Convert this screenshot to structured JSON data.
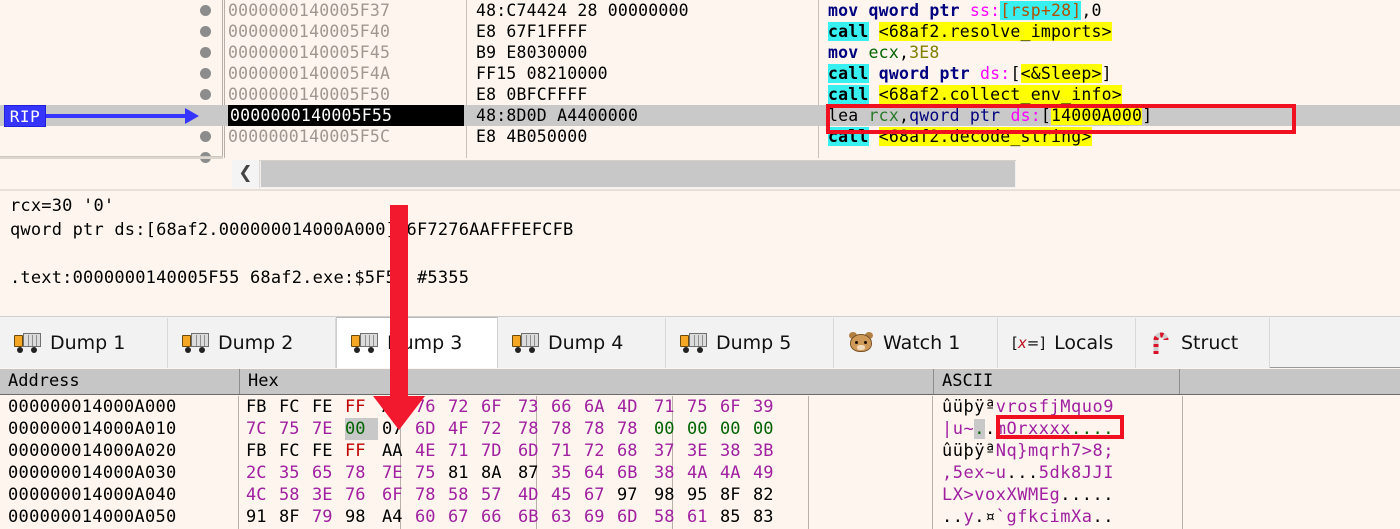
{
  "disassembly": {
    "rows": [
      {
        "address": "0000000140005F37",
        "bytes": "48:C74424 28 00000000",
        "selected": false,
        "tokens": [
          {
            "t": "mov",
            "c": "mn"
          },
          {
            "t": " qword ptr ",
            "c": "mn"
          },
          {
            "t": "ss:",
            "c": "seg"
          },
          {
            "t": "[",
            "c": "brk"
          },
          {
            "t": "rsp+",
            "c": "regred"
          },
          {
            "t": "28",
            "c": "numbr"
          },
          {
            "t": "]",
            "c": "brk"
          },
          {
            "t": ",0",
            "c": "dark"
          }
        ]
      },
      {
        "address": "0000000140005F40",
        "bytes": "E8 67F1FFFF",
        "selected": false,
        "tokens": [
          {
            "t": "call",
            "c": "call"
          },
          {
            "t": " ",
            "c": "dark"
          },
          {
            "t": "<68af2.resolve_imports>",
            "c": "sym"
          }
        ]
      },
      {
        "address": "0000000140005F45",
        "bytes": "B9 E8030000",
        "selected": false,
        "tokens": [
          {
            "t": "mov",
            "c": "mn"
          },
          {
            "t": " ",
            "c": "dark"
          },
          {
            "t": "ecx",
            "c": "reg"
          },
          {
            "t": ",",
            "c": "dark"
          },
          {
            "t": "3E8",
            "c": "num"
          }
        ]
      },
      {
        "address": "0000000140005F4A",
        "bytes": "FF15 08210000",
        "selected": false,
        "tokens": [
          {
            "t": "call",
            "c": "call"
          },
          {
            "t": " ",
            "c": "dark"
          },
          {
            "t": "qword ptr ",
            "c": "mn"
          },
          {
            "t": "ds:",
            "c": "seg"
          },
          {
            "t": "[",
            "c": "dark"
          },
          {
            "t": "<&Sleep>",
            "c": "sym"
          },
          {
            "t": "]",
            "c": "dark"
          }
        ]
      },
      {
        "address": "0000000140005F50",
        "bytes": "E8 0BFCFFFF",
        "selected": false,
        "tokens": [
          {
            "t": "call",
            "c": "call"
          },
          {
            "t": " ",
            "c": "dark"
          },
          {
            "t": "<68af2.collect_env_info>",
            "c": "sym"
          }
        ]
      },
      {
        "address": "0000000140005F55",
        "bytes": "48:8D0D A4400000",
        "selected": true,
        "tokens": [
          {
            "t": "lea",
            "c": "lea"
          },
          {
            "t": " ",
            "c": "dark"
          },
          {
            "t": "rcx",
            "c": "leareg"
          },
          {
            "t": ",",
            "c": "dark"
          },
          {
            "t": "qword ptr ",
            "c": "mem"
          },
          {
            "t": "ds:",
            "c": "seg"
          },
          {
            "t": "[",
            "c": "dark"
          },
          {
            "t": "14000A000",
            "c": "sym"
          },
          {
            "t": "]",
            "c": "dark"
          }
        ]
      },
      {
        "address": "0000000140005F5C",
        "bytes": "E8 4B050000",
        "selected": false,
        "tokens": [
          {
            "t": "call",
            "c": "call"
          },
          {
            "t": " ",
            "c": "dark"
          },
          {
            "t": "<68af2.decode_string>",
            "c": "sym"
          }
        ]
      }
    ],
    "rip_label": "RIP",
    "scroll_left_glyph": "❮"
  },
  "info_panel": {
    "lines": [
      "rcx=30 '0'",
      "qword ptr ds:[68af2.000000014000A000]=6F7276AAFFFEFCFB",
      "",
      ".text:0000000140005F55 68af2.exe:$5F55 #5355"
    ]
  },
  "tabs": [
    {
      "label": "Dump 1",
      "icon": "dump-truck-icon",
      "active": false
    },
    {
      "label": "Dump 2",
      "icon": "dump-truck-icon",
      "active": false
    },
    {
      "label": "Dump 3",
      "icon": "dump-truck-icon",
      "active": true
    },
    {
      "label": "Dump 4",
      "icon": "dump-truck-icon",
      "active": false
    },
    {
      "label": "Dump 5",
      "icon": "dump-truck-icon",
      "active": false
    },
    {
      "label": "Watch 1",
      "icon": "hamster-icon",
      "active": false
    },
    {
      "label": "Locals",
      "icon": "variable-icon",
      "active": false
    },
    {
      "label": "Struct",
      "icon": "candy-cane-icon",
      "active": false
    }
  ],
  "dump": {
    "columns": [
      "Address",
      "Hex",
      "ASCII"
    ],
    "rows": [
      {
        "address": "000000014000A000",
        "bytes": [
          "FB",
          "FC",
          "FE",
          "FF",
          "AA",
          "76",
          "72",
          "6F",
          "73",
          "66",
          "6A",
          "4D",
          "71",
          "75",
          "6F",
          "39"
        ],
        "kinds": [
          "hi",
          "hi",
          "hi",
          "ff",
          "hi",
          "pr",
          "pr",
          "pr",
          "pr",
          "pr",
          "pr",
          "pr",
          "pr",
          "pr",
          "pr",
          "pr"
        ],
        "ascii": "ûüþÿªvrosfjMquo9",
        "ascii_kinds": [
          "hi",
          "hi",
          "hi",
          "hi",
          "hi",
          "pr",
          "pr",
          "pr",
          "pr",
          "pr",
          "pr",
          "pr",
          "pr",
          "pr",
          "pr",
          "pr"
        ]
      },
      {
        "address": "000000014000A010",
        "bytes": [
          "7C",
          "75",
          "7E",
          "00",
          "07",
          "6D",
          "4F",
          "72",
          "78",
          "78",
          "78",
          "78",
          "00",
          "00",
          "00",
          "00"
        ],
        "kinds": [
          "pr",
          "pr",
          "pr",
          "zero-sel",
          "hi",
          "pr",
          "pr",
          "pr",
          "pr",
          "pr",
          "pr",
          "pr",
          "zero",
          "zero",
          "zero",
          "zero"
        ],
        "ascii": "|u~..mOrxxxx....",
        "ascii_kinds": [
          "pr",
          "pr",
          "pr",
          "zero-sel",
          "hi",
          "pr",
          "pr",
          "pr",
          "pr",
          "pr",
          "pr",
          "pr",
          "zero",
          "zero",
          "zero",
          "zero"
        ]
      },
      {
        "address": "000000014000A020",
        "bytes": [
          "FB",
          "FC",
          "FE",
          "FF",
          "AA",
          "4E",
          "71",
          "7D",
          "6D",
          "71",
          "72",
          "68",
          "37",
          "3E",
          "38",
          "3B"
        ],
        "kinds": [
          "hi",
          "hi",
          "hi",
          "ff",
          "hi",
          "pr",
          "pr",
          "pr",
          "pr",
          "pr",
          "pr",
          "pr",
          "pr",
          "pr",
          "pr",
          "pr"
        ],
        "ascii": "ûüþÿªNq}mqrh7>8;",
        "ascii_kinds": [
          "hi",
          "hi",
          "hi",
          "hi",
          "hi",
          "pr",
          "pr",
          "pr",
          "pr",
          "pr",
          "pr",
          "pr",
          "pr",
          "pr",
          "pr",
          "pr"
        ]
      },
      {
        "address": "000000014000A030",
        "bytes": [
          "2C",
          "35",
          "65",
          "78",
          "7E",
          "75",
          "81",
          "8A",
          "87",
          "35",
          "64",
          "6B",
          "38",
          "4A",
          "4A",
          "49"
        ],
        "kinds": [
          "pr",
          "pr",
          "pr",
          "pr",
          "pr",
          "pr",
          "hi",
          "hi",
          "hi",
          "pr",
          "pr",
          "pr",
          "pr",
          "pr",
          "pr",
          "pr"
        ],
        "ascii": ",5ex~u...5dk8JJI",
        "ascii_kinds": [
          "pr",
          "pr",
          "pr",
          "pr",
          "pr",
          "pr",
          "hi",
          "hi",
          "hi",
          "pr",
          "pr",
          "pr",
          "pr",
          "pr",
          "pr",
          "pr"
        ]
      },
      {
        "address": "000000014000A040",
        "bytes": [
          "4C",
          "58",
          "3E",
          "76",
          "6F",
          "78",
          "58",
          "57",
          "4D",
          "45",
          "67",
          "97",
          "98",
          "95",
          "8F",
          "82"
        ],
        "kinds": [
          "pr",
          "pr",
          "pr",
          "pr",
          "pr",
          "pr",
          "pr",
          "pr",
          "pr",
          "pr",
          "pr",
          "hi",
          "hi",
          "hi",
          "hi",
          "hi"
        ],
        "ascii": "LX>voxXWMEg.....",
        "ascii_kinds": [
          "pr",
          "pr",
          "pr",
          "pr",
          "pr",
          "pr",
          "pr",
          "pr",
          "pr",
          "pr",
          "pr",
          "hi",
          "hi",
          "hi",
          "hi",
          "hi"
        ]
      },
      {
        "address": "000000014000A050",
        "bytes": [
          "91",
          "8F",
          "79",
          "98",
          "A4",
          "60",
          "67",
          "66",
          "6B",
          "63",
          "69",
          "6D",
          "58",
          "61",
          "85",
          "83"
        ],
        "kinds": [
          "hi",
          "hi",
          "pr",
          "hi",
          "hi",
          "pr",
          "pr",
          "pr",
          "pr",
          "pr",
          "pr",
          "pr",
          "pr",
          "pr",
          "hi",
          "hi"
        ],
        "ascii": "..y.¤`gfkcimXa..",
        "ascii_kinds": [
          "hi",
          "hi",
          "pr",
          "hi",
          "hi",
          "pr",
          "pr",
          "pr",
          "pr",
          "pr",
          "pr",
          "pr",
          "pr",
          "pr",
          "hi",
          "hi"
        ]
      }
    ]
  },
  "annotations": {
    "lea_highlight_color": "#f01020",
    "ascii_highlight_color": "#f01020",
    "arrow_color": "#f2182e",
    "rip_color": "#3535ff"
  }
}
